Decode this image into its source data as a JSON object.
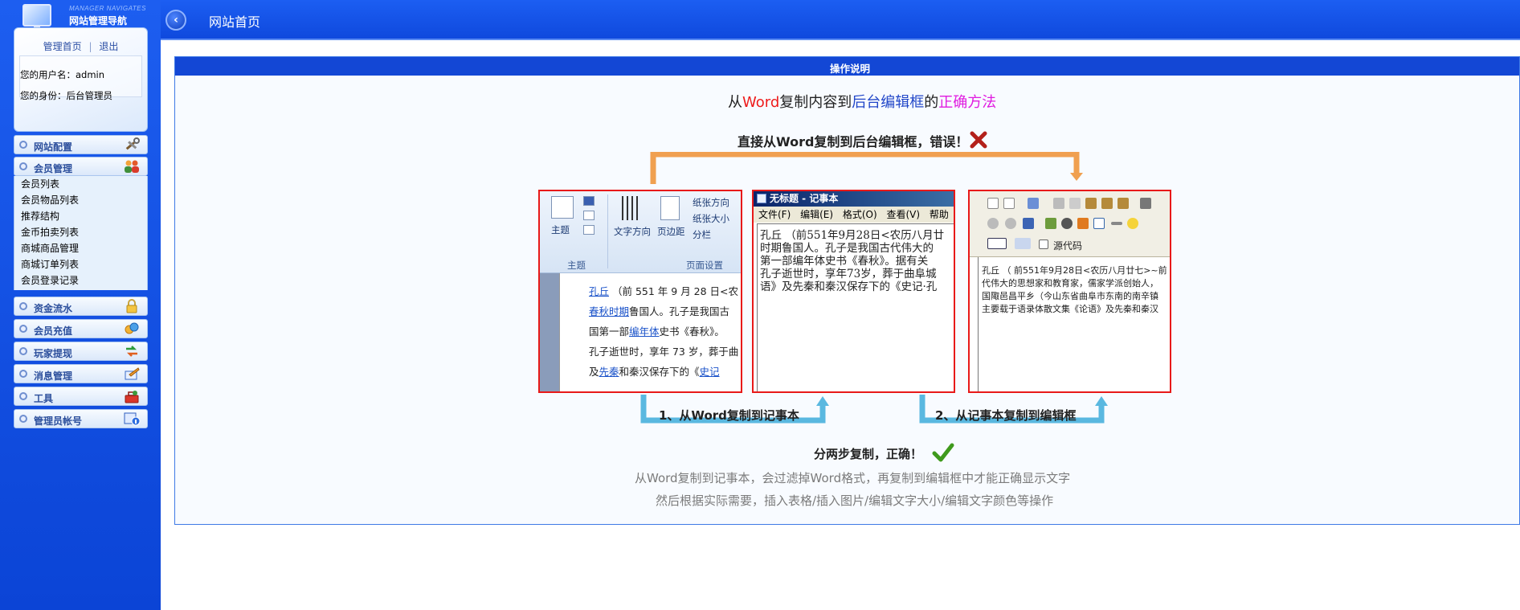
{
  "logo": {
    "subtitle_en": "MANAGER NAVIGATES",
    "title": "网站管理导航"
  },
  "userbox": {
    "home_link": "管理首页",
    "logout_link": "退出",
    "username_line": "您的用户名：admin",
    "role_line": "您的身份：后台管理员"
  },
  "sidebar": {
    "menus": [
      {
        "label": "网站配置",
        "icon": "tools-icon"
      },
      {
        "label": "会员管理",
        "icon": "members-icon"
      },
      {
        "label": "资金流水",
        "icon": "lock-icon"
      },
      {
        "label": "会员充值",
        "icon": "coins-icon"
      },
      {
        "label": "玩家提现",
        "icon": "transfer-icon"
      },
      {
        "label": "消息管理",
        "icon": "message-icon"
      },
      {
        "label": "工具",
        "icon": "toolbox-icon"
      },
      {
        "label": "管理员帐号",
        "icon": "admin-icon"
      }
    ],
    "member_items": [
      "会员列表",
      "会员物品列表",
      "推荐结构",
      "金币拍卖列表",
      "商城商品管理",
      "商城订单列表",
      "会员登录记录"
    ]
  },
  "header": {
    "title": "网站首页"
  },
  "panel": {
    "bar_title": "操作说明",
    "title_parts": [
      "从",
      "Word",
      "复制内容到",
      "后台编辑框",
      "的",
      "正确方法"
    ],
    "wrong_line": "直接从Word复制到后台编辑框，错误！",
    "step1": "1、从Word复制到记事本",
    "step2": "2、从记事本复制到编辑框",
    "ok_line": "分两步复制，正确！",
    "desc1": "从Word复制到记事本，会过滤掉Word格式，再复制到编辑框中才能正确显示文字",
    "desc2": "然后根据实际需要，插入表格/插入图片/编辑文字大小/编辑文字颜色等操作"
  },
  "word_shot": {
    "ribbon_labels": [
      "主题",
      "文字方向",
      "页边距",
      "纸张方向",
      "纸张大小",
      "分栏"
    ],
    "group_labels": [
      "主题",
      "页面设置"
    ],
    "lines": [
      [
        "孔丘",
        "（前 551 年 9 月 28 日<农"
      ],
      [
        "春秋时期",
        "鲁国人。孔子是我国古"
      ],
      [
        "国第一部",
        "编年体",
        "史书《春秋》。"
      ],
      [
        "孔子逝世时，享年 73 岁，葬于曲"
      ],
      [
        "及",
        "先秦",
        "和秦汉保存下的《",
        "史记"
      ]
    ]
  },
  "notepad_shot": {
    "title": "无标题 - 记事本",
    "menu": "文件(F) 编辑(E) 格式(O) 查看(V) 帮助",
    "lines": [
      "孔丘 （前551年9月28日<农历八月廿",
      "时期鲁国人。孔子是我国古代伟大的",
      "第一部编年体史书《春秋》。据有关",
      "孔子逝世时，享年73岁，葬于曲阜城",
      "语》及先秦和秦汉保存下的《史记·孔"
    ]
  },
  "editor_shot": {
    "source_label": "源代码",
    "lines": [
      "孔丘 （ 前551年9月28日<农历八月廿七>~前",
      "代伟大的思想家和教育家，儒家学派创始人，",
      "国陬邑昌平乡（今山东省曲阜市东南的南辛镇",
      "主要载于语录体散文集《论语》及先秦和秦汉"
    ]
  }
}
